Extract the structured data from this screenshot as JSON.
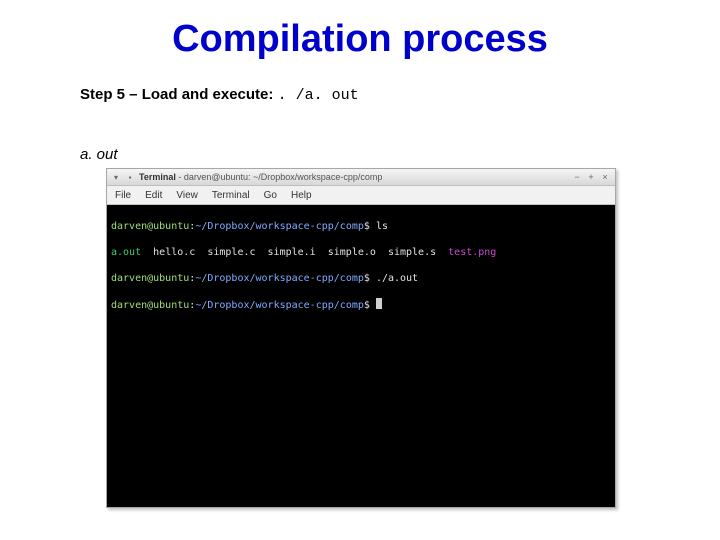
{
  "title": "Compilation process",
  "step": {
    "label": "Step 5 – Load and execute:",
    "cmd": ". /a. out"
  },
  "filename": "a. out",
  "termwin": {
    "title_app": "Terminal",
    "title_rest": " - darven@ubuntu: ~/Dropbox/workspace-cpp/comp",
    "menu": [
      "File",
      "Edit",
      "View",
      "Terminal",
      "Go",
      "Help"
    ],
    "prompt_user_host": "darven@ubuntu",
    "prompt_sep": ":",
    "prompt_path": "~/Dropbox/workspace-cpp/comp",
    "prompt_end": "$ ",
    "lines": {
      "l1_cmd": "ls",
      "ls": {
        "aout": "a.out",
        "rest": "  hello.c  simple.c  simple.i  simple.o  simple.s  ",
        "png": "test.png"
      },
      "l3_cmd": "./a.out"
    }
  }
}
